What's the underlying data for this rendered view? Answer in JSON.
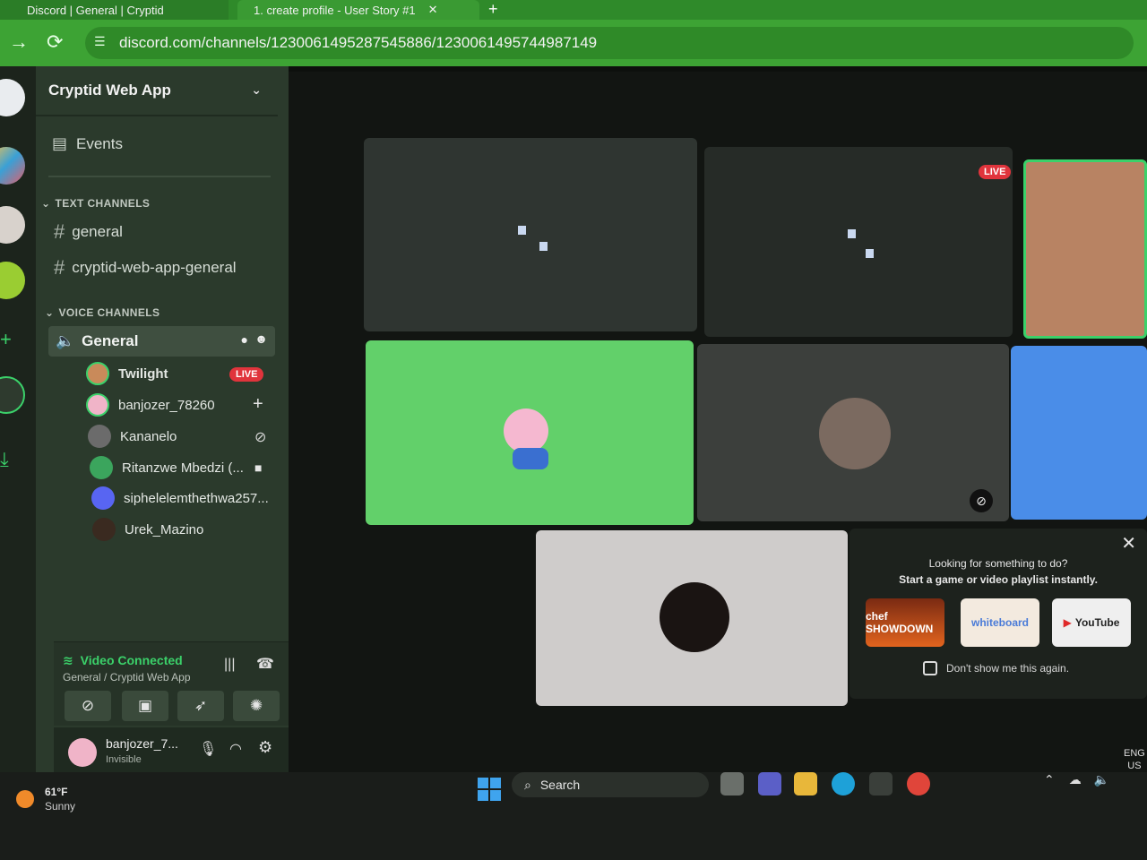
{
  "browser": {
    "tab1_title": "Discord | General | Cryptid",
    "tab2_title": "1. create profile - User Story #1",
    "new_tab_label": "+",
    "url": "discord.com/channels/1230061495287545886/1230061495744987149"
  },
  "sidebar": {
    "server_name": "Cryptid Web App",
    "events_label": "Events",
    "text_category": "TEXT CHANNELS",
    "text_channels": [
      "general",
      "cryptid-web-app-general"
    ],
    "voice_category": "VOICE CHANNELS",
    "voice_channel": "General",
    "voice_users": [
      {
        "name": "Twilight",
        "badge": "LIVE",
        "status_icon": "live-badge"
      },
      {
        "name": "banjozer_78260",
        "status_icon": "plus-icon"
      },
      {
        "name": "Kananelo",
        "status_icon": "muted-mic-icon"
      },
      {
        "name": "Ritanzwe Mbedzi (...",
        "status_icon": "video-camera-icon"
      },
      {
        "name": "siphelelemthethwa257...",
        "status_icon": ""
      },
      {
        "name": "Urek_Mazino",
        "status_icon": ""
      }
    ]
  },
  "voice_panel": {
    "status": "Video Connected",
    "location": "General / Cryptid Web App"
  },
  "user_panel": {
    "username": "banjozer_7...",
    "status": "Invisible"
  },
  "stage": {
    "live_badge": "LIVE"
  },
  "activity_card": {
    "line1": "Looking for something to do?",
    "line2": "Start a game or video playlist instantly.",
    "activities": [
      "chef SHOWDOWN",
      "whiteboard",
      "YouTube"
    ],
    "dont_show": "Don't show me this again."
  },
  "taskbar": {
    "temperature": "61°F",
    "condition": "Sunny",
    "search_label": "Search",
    "lang1": "ENG",
    "lang2": "US"
  },
  "colors": {
    "accent_green": "#3bd16a",
    "live_red": "#e0343c",
    "browser_green": "#3da334"
  }
}
